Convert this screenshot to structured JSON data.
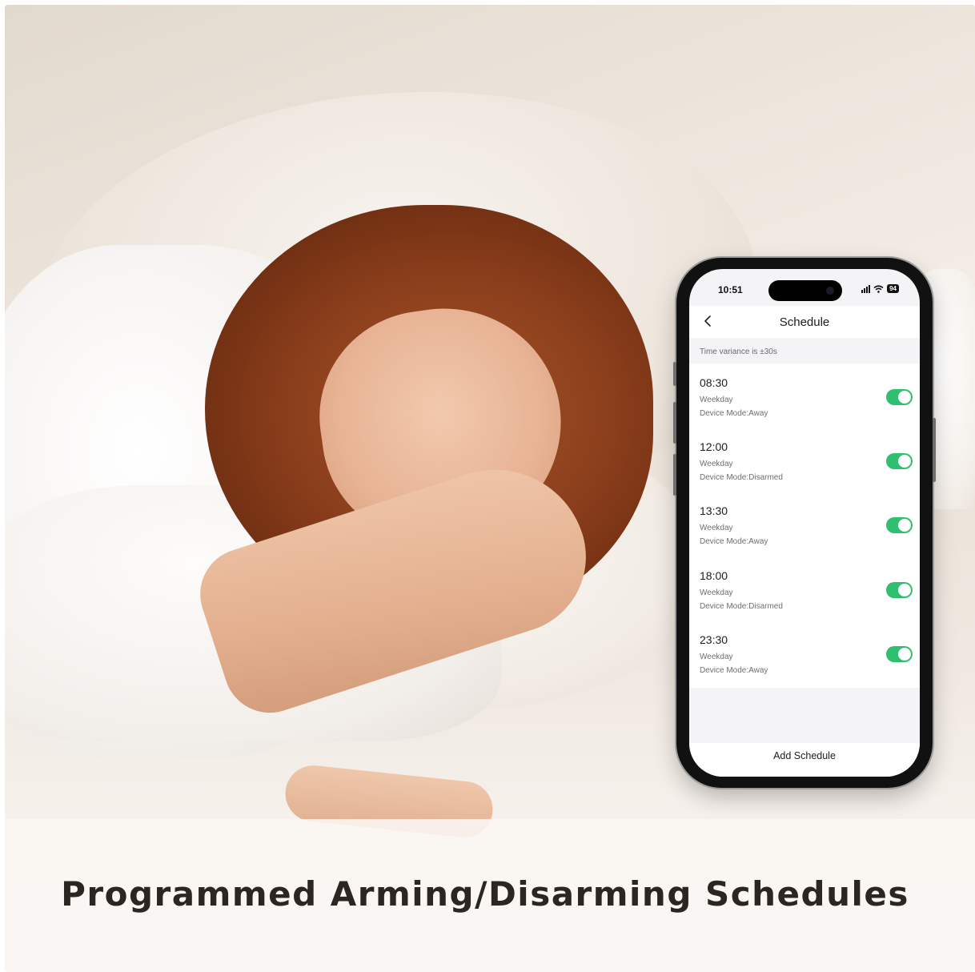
{
  "caption": "Programmed Arming/Disarming Schedules",
  "phone": {
    "status_bar": {
      "time": "10:51",
      "battery": "94",
      "icons": [
        "signal-icon",
        "wifi-icon",
        "battery-icon"
      ]
    },
    "nav": {
      "title": "Schedule",
      "back_icon": "chevron-left-icon"
    },
    "notice": "Time variance is ±30s",
    "schedules": [
      {
        "time": "08:30",
        "repeat": "Weekday",
        "mode": "Device Mode:Away",
        "enabled": true
      },
      {
        "time": "12:00",
        "repeat": "Weekday",
        "mode": "Device Mode:Disarmed",
        "enabled": true
      },
      {
        "time": "13:30",
        "repeat": "Weekday",
        "mode": "Device Mode:Away",
        "enabled": true
      },
      {
        "time": "18:00",
        "repeat": "Weekday",
        "mode": "Device Mode:Disarmed",
        "enabled": true
      },
      {
        "time": "23:30",
        "repeat": "Weekday",
        "mode": "Device Mode:Away",
        "enabled": true
      }
    ],
    "add_button": "Add Schedule",
    "colors": {
      "toggle_on": "#2fbf71",
      "list_bg": "#ffffff",
      "screen_bg": "#f4f4f6"
    }
  }
}
